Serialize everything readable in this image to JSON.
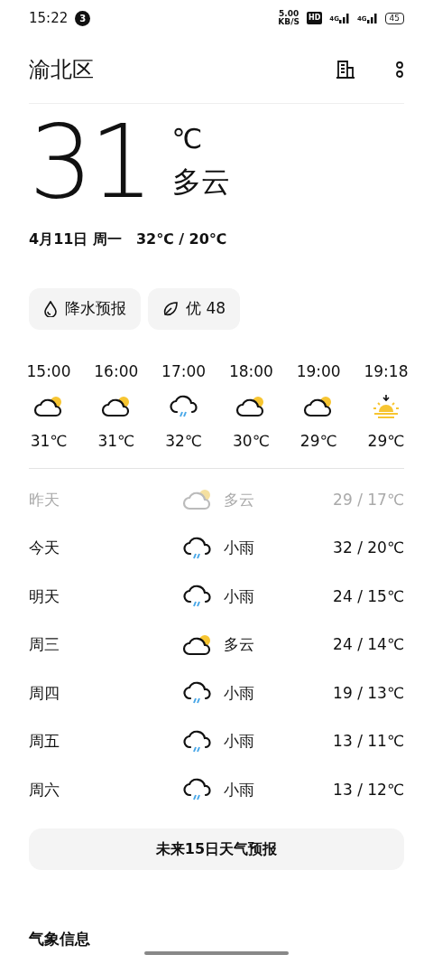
{
  "status_bar": {
    "time": "15:22",
    "notification_count": "3",
    "speed": "5.00",
    "speed_unit": "KB/S",
    "hd": "HD",
    "networks": [
      "4G",
      "4G"
    ],
    "battery": "45"
  },
  "header": {
    "location": "渝北区"
  },
  "current": {
    "temperature": "31",
    "unit": "℃",
    "condition": "多云",
    "date": "4月11日 周一",
    "range": "32℃ / 20℃"
  },
  "chips": [
    {
      "kind": "drop",
      "label": "降水预报"
    },
    {
      "kind": "leaf",
      "label": "优 48"
    }
  ],
  "hourly": [
    {
      "time": "15:00",
      "kind": "cloudy",
      "temp": "31℃"
    },
    {
      "time": "16:00",
      "kind": "cloudy",
      "temp": "31℃"
    },
    {
      "time": "17:00",
      "kind": "rain",
      "temp": "32℃"
    },
    {
      "time": "18:00",
      "kind": "cloudy",
      "temp": "30℃"
    },
    {
      "time": "19:00",
      "kind": "cloudy",
      "temp": "29℃"
    },
    {
      "time": "19:18",
      "kind": "sunset",
      "temp": "29℃"
    }
  ],
  "daily": [
    {
      "day": "昨天",
      "kind": "cloudy",
      "condition": "多云",
      "range": "29 / 17℃",
      "past": true
    },
    {
      "day": "今天",
      "kind": "rain",
      "condition": "小雨",
      "range": "32 / 20℃",
      "past": false
    },
    {
      "day": "明天",
      "kind": "rain",
      "condition": "小雨",
      "range": "24 / 15℃",
      "past": false
    },
    {
      "day": "周三",
      "kind": "cloudy",
      "condition": "多云",
      "range": "24 / 14℃",
      "past": false
    },
    {
      "day": "周四",
      "kind": "rain",
      "condition": "小雨",
      "range": "19 / 13℃",
      "past": false
    },
    {
      "day": "周五",
      "kind": "rain",
      "condition": "小雨",
      "range": "13 / 11℃",
      "past": false
    },
    {
      "day": "周六",
      "kind": "rain",
      "condition": "小雨",
      "range": "13 / 12℃",
      "past": false
    }
  ],
  "forecast_button": "未来15日天气预报",
  "section_title": "气象信息"
}
